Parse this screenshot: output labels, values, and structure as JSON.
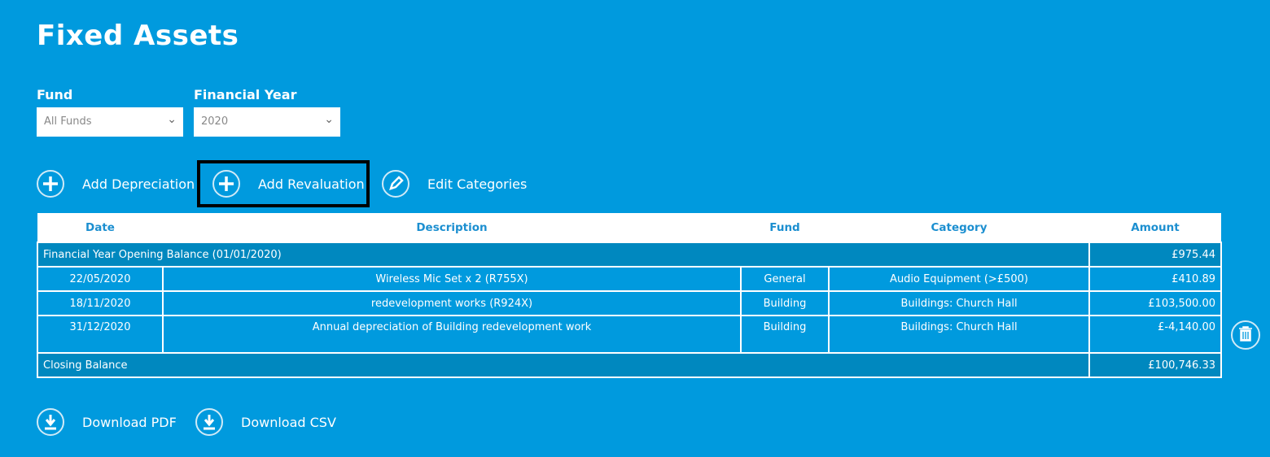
{
  "title": "Fixed Assets",
  "filters": {
    "fund_label": "Fund",
    "fund_value": "All Funds",
    "year_label": "Financial Year",
    "year_value": "2020"
  },
  "actions": {
    "add_depreciation": "Add Depreciation",
    "add_revaluation": "Add Revaluation",
    "edit_categories": "Edit Categories",
    "download_pdf": "Download PDF",
    "download_csv": "Download CSV"
  },
  "table": {
    "headers": [
      "Date",
      "Description",
      "Fund",
      "Category",
      "Amount"
    ],
    "opening": {
      "label": "Financial Year Opening Balance (01/01/2020)",
      "amount": "£975.44"
    },
    "rows": [
      {
        "date": "22/05/2020",
        "description": "Wireless Mic Set x 2 (R755X)",
        "fund": "General",
        "category": "Audio Equipment (>£500)",
        "amount": "£410.89"
      },
      {
        "date": "18/11/2020",
        "description": "redevelopment works (R924X)",
        "fund": "Building",
        "category": "Buildings: Church Hall",
        "amount": "£103,500.00"
      },
      {
        "date": "31/12/2020",
        "description": "Annual depreciation of Building redevelopment work",
        "fund": "Building",
        "category": "Buildings: Church Hall",
        "amount": "£-4,140.00"
      }
    ],
    "closing": {
      "label": "Closing Balance",
      "amount": "£100,746.33"
    }
  },
  "colors": {
    "background": "#009ade",
    "dark_row": "#0088bf",
    "header_text": "#1c8fd0"
  }
}
